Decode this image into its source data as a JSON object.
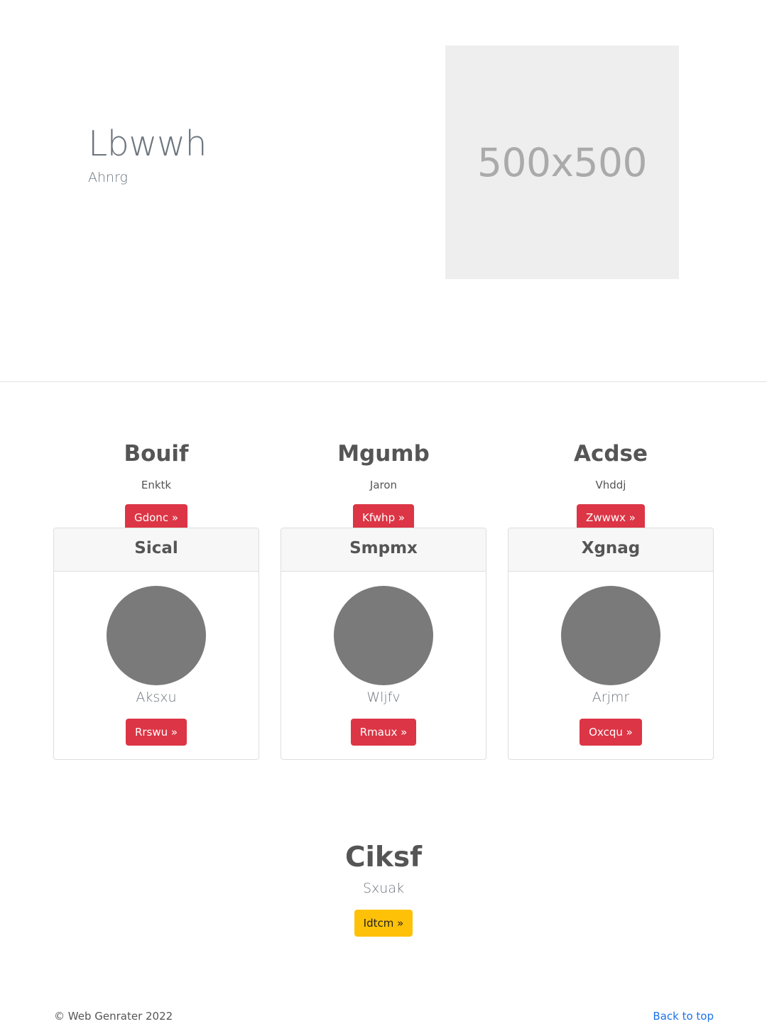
{
  "hero": {
    "title": "Lbwwh",
    "subtitle": "Ahnrg",
    "image_placeholder": "500x500"
  },
  "features": [
    {
      "title": "Bouif",
      "text": "Enktk",
      "button": "Gdonc »"
    },
    {
      "title": "Mgumb",
      "text": "Jaron",
      "button": "Kfwhp »"
    },
    {
      "title": "Acdse",
      "text": "Vhddj",
      "button": "Zwwwx »"
    }
  ],
  "cards": [
    {
      "header": "Sical",
      "caption": "Aksxu",
      "button": "Rrswu »"
    },
    {
      "header": "Smpmx",
      "caption": "Wljfv",
      "button": "Rmaux »"
    },
    {
      "header": "Xgnag",
      "caption": "Arjmr",
      "button": "Oxcqu »"
    }
  ],
  "cta": {
    "title": "Ciksf",
    "subtitle": "Sxuak",
    "button": "Idtcm »"
  },
  "footer": {
    "copyright": "© Web Genrater 2022",
    "back_to_top": "Back to top"
  },
  "colors": {
    "button_primary": "#dc3545",
    "button_warning": "#ffc107",
    "link": "#1a73e8",
    "avatar": "#7a7a7a",
    "placeholder_bg": "#eeeeee"
  }
}
